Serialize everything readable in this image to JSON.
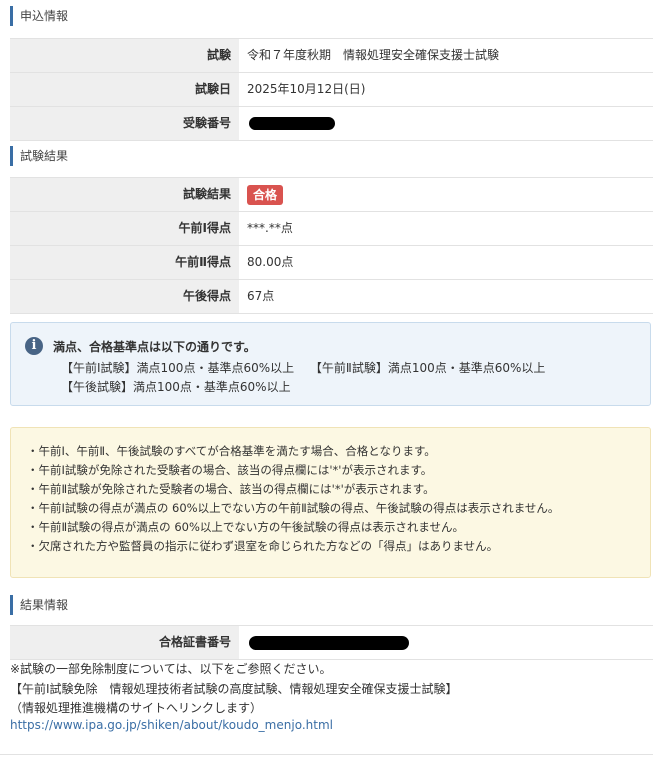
{
  "application": {
    "title": "申込情報",
    "rows": [
      {
        "label": "試験",
        "value": "令和７年度秋期　情報処理安全確保支援士試験"
      },
      {
        "label": "試験日",
        "value": "2025年10月12日(日)"
      },
      {
        "label": "受験番号",
        "value": ""
      }
    ]
  },
  "results": {
    "title": "試験結果",
    "rows": [
      {
        "label": "試験結果",
        "badge": "合格"
      },
      {
        "label": "午前Ⅰ得点",
        "value": "***.**点"
      },
      {
        "label": "午前Ⅱ得点",
        "value": "80.00点"
      },
      {
        "label": "午後得点",
        "value": "67点"
      }
    ]
  },
  "info": {
    "title": "満点、合格基準点は以下の通りです。",
    "line1": "【午前Ⅰ試験】満点100点・基準点60%以上　 【午前Ⅱ試験】満点100点・基準点60%以上",
    "line2": "【午後試験】満点100点・基準点60%以上"
  },
  "notes": [
    "・午前Ⅰ、午前Ⅱ、午後試験のすべてが合格基準を満たす場合、合格となります。",
    "・午前Ⅰ試験が免除された受験者の場合、該当の得点欄には'*'が表示されます。",
    "・午前Ⅱ試験が免除された受験者の場合、該当の得点欄には'*'が表示されます。",
    "・午前Ⅰ試験の得点が満点の 60%以上でない方の午前Ⅱ試験の得点、午後試験の得点は表示されません。",
    "・午前Ⅱ試験の得点が満点の 60%以上でない方の午後試験の得点は表示されません。",
    "・欠席された方や監督員の指示に従わず退室を命じられた方などの「得点」はありません。"
  ],
  "result_info": {
    "title": "結果情報",
    "row_label": "合格証書番号"
  },
  "footer": {
    "line1": "※試験の一部免除制度については、以下をご参照ください。",
    "line2": "【午前Ⅰ試験免除　情報処理技術者試験の高度試験、情報処理安全確保支援士試験】",
    "line3": "（情報処理推進機構のサイトへリンクします）",
    "link": "https://www.ipa.go.jp/shiken/about/koudo_menjo.html"
  },
  "colors": {
    "accent": "#3a6ea5",
    "pass_badge": "#d9534f",
    "info_bg": "#eef4fa",
    "warn_bg": "#fcf8e3"
  }
}
